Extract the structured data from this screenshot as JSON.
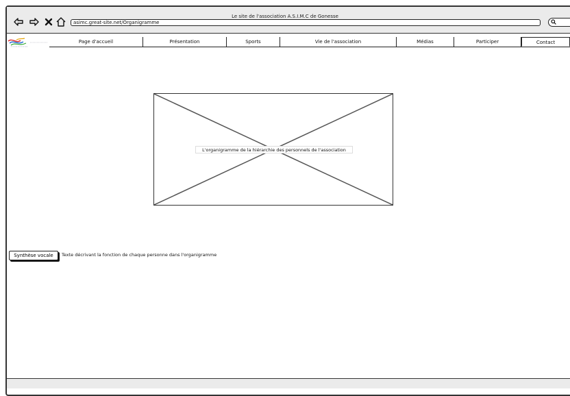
{
  "window": {
    "title": "Le site de l'association A.S.I.M.C de Gonesse",
    "address": "asimc.great-site.net/Organigramme"
  },
  "toolbar": {
    "back_icon": "arrow-left-icon",
    "forward_icon": "arrow-right-icon",
    "stop_icon": "close-icon",
    "home_icon": "home-icon",
    "search_icon": "search-icon"
  },
  "nav": {
    "items": [
      {
        "label": "Page d'accueil"
      },
      {
        "label": "Présentation"
      },
      {
        "label": "Sports"
      },
      {
        "label": "Vie de l'association"
      },
      {
        "label": "Médias"
      },
      {
        "label": "Participer"
      },
      {
        "label": "Contact"
      }
    ],
    "active": "Contact"
  },
  "main": {
    "image_placeholder": "L'organigramme de la hiérarchie des personnels de l'association",
    "tts_button": "Synthèse vocale",
    "description": "Texte décrivant la fonction de chaque personne dans l'organigramme"
  }
}
